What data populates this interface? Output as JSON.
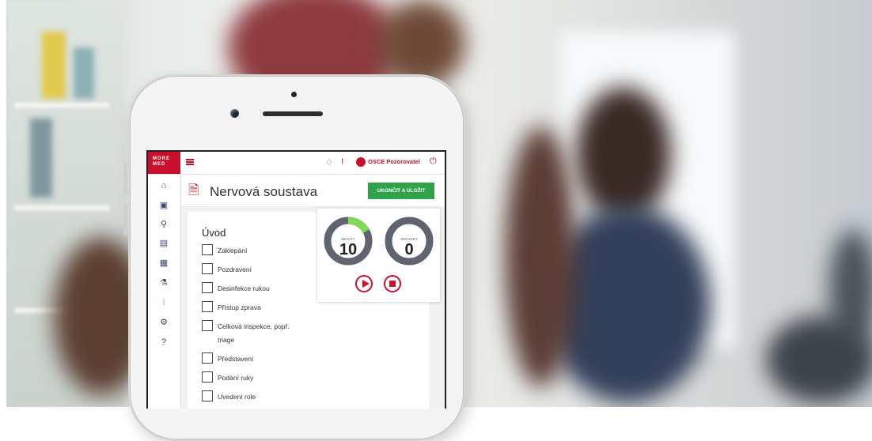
{
  "app": {
    "logo_text": "MORE MED",
    "user_name": "OSCE Pozorovatel",
    "icons": [
      "menu-icon",
      "bell-icon",
      "alert-icon",
      "user-avatar-icon",
      "power-icon"
    ]
  },
  "sidebar": {
    "items": [
      {
        "icon": "home-icon",
        "glyph": "⌂"
      },
      {
        "icon": "clipboard-icon",
        "glyph": "▣"
      },
      {
        "icon": "search-icon",
        "glyph": "⚲"
      },
      {
        "icon": "screen-icon",
        "glyph": "▤"
      },
      {
        "icon": "form-icon",
        "glyph": "▦"
      },
      {
        "icon": "flask-icon",
        "glyph": "⚗"
      },
      {
        "icon": "chart-icon",
        "glyph": "⫶"
      },
      {
        "icon": "settings-icon",
        "glyph": "⚙"
      },
      {
        "icon": "help-icon",
        "glyph": "?"
      }
    ]
  },
  "header": {
    "title": "Nervová soustava",
    "save_label": "UKONČIT A ULOŽIT"
  },
  "checklist": {
    "section_title": "Úvod",
    "items": [
      {
        "label": "Zaklepání",
        "checked": false
      },
      {
        "label": "Pozdravení",
        "checked": false
      },
      {
        "label": "Desinfekce rukou",
        "checked": false
      },
      {
        "label": "Přístup zprava",
        "checked": false
      },
      {
        "label": "Celková inspekce, popř.",
        "label2": "triage",
        "checked": false
      },
      {
        "label": "Představení",
        "checked": false
      },
      {
        "label": "Podání ruky",
        "checked": false
      },
      {
        "label": "Uvedení role",
        "checked": false
      }
    ]
  },
  "timer": {
    "left": {
      "caption": "MINUTY",
      "value": "10",
      "progress": 0.17,
      "accent": "#7ed957"
    },
    "right": {
      "caption": "SEKUNDY",
      "value": "0",
      "progress": 0
    }
  },
  "colors": {
    "brand": "#c8102e",
    "save": "#2fa24a",
    "gauge_track": "#5f6470"
  }
}
